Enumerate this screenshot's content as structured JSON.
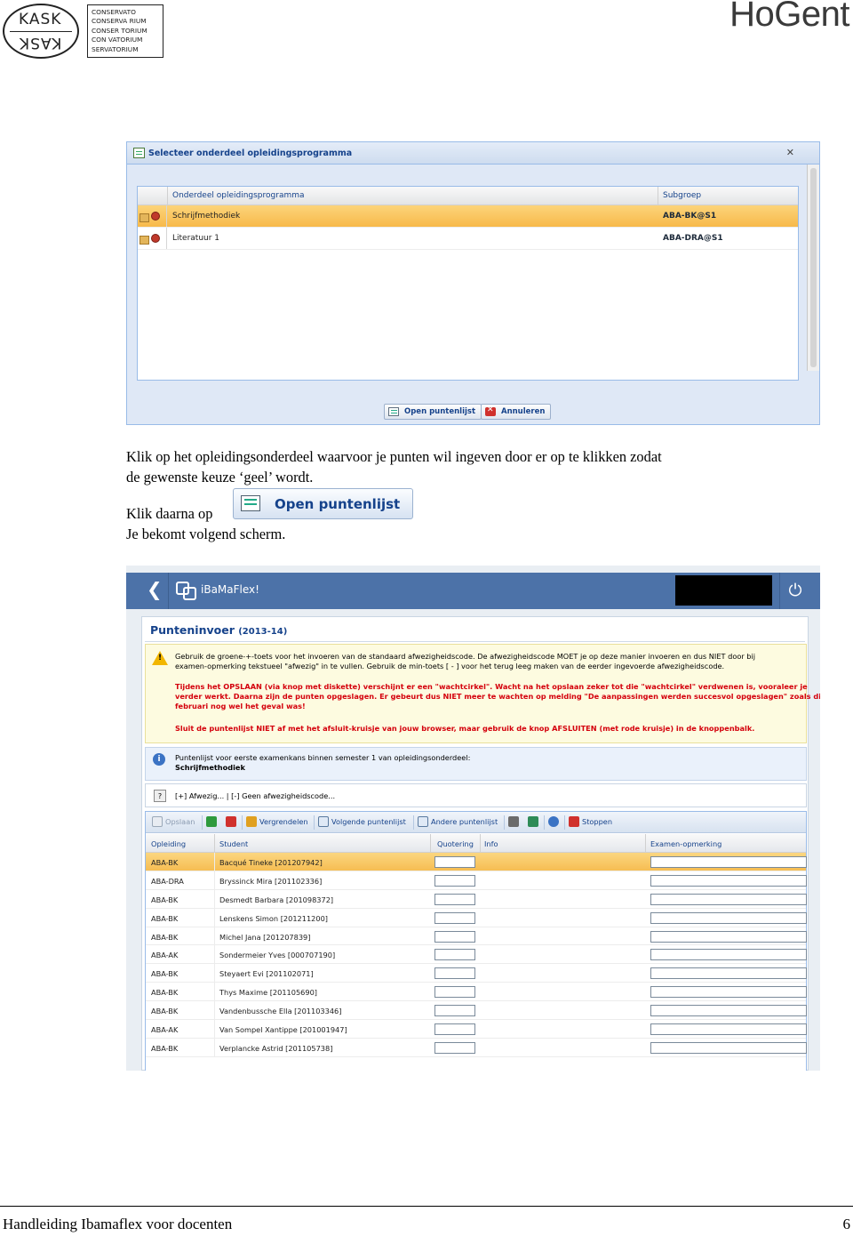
{
  "header": {
    "kask_logo_top": "KASK",
    "kask_logo_bottom": "KASK",
    "conservatorium_lines": [
      "CONSERVATO",
      "CONSERVA RIUM",
      "CONSER TORIUM",
      "CON VATORIUM",
      "SERVATORIUM"
    ],
    "hogent_logo": "HoGent"
  },
  "dialog": {
    "title": "Selecteer onderdeel opleidingsprogramma",
    "columns": [
      "Onderdeel opleidingsprogramma",
      "Subgroep"
    ],
    "rows": [
      {
        "onderdeel": "Schrijfmethodiek",
        "subgroep": "ABA-BK@S1",
        "selected": true
      },
      {
        "onderdeel": "Literatuur 1",
        "subgroep": "ABA-DRA@S1",
        "selected": false
      }
    ],
    "open_button": "Open puntenlijst",
    "cancel_button": "Annuleren",
    "close_glyph": "✕"
  },
  "text": {
    "line1": "Klik op het opleidingsonderdeel waarvoor je punten wil ingeven door er op te klikken zodat",
    "line2": "de gewenste keuze ‘geel’ wordt.",
    "line3": "Klik daarna op",
    "inline_button": "Open puntenlijst",
    "line4": "Je bekomt volgend scherm."
  },
  "app": {
    "name": "iBaMaFlex!",
    "back_glyph": "❮",
    "power_glyph": "⏻",
    "title": "Punteninvoer",
    "title_year": "(2013-14)",
    "warning_lines": [
      "Gebruik de groene-+-toets voor het invoeren van de standaard afwezigheidscode. De afwezigheidscode MOET je op deze manier invoeren en dus NIET door bij",
      "examen-opmerking tekstueel \"afwezig\" in te vullen. Gebruik de min-toets [ - ] voor het terug leeg maken van de eerder ingevoerde afwezigheidscode."
    ],
    "warning_red_lines": [
      "Tijdens het OPSLAAN (via knop met diskette) verschijnt er een \"wachtcirkel\". Wacht na het opslaan zeker tot die \"wachtcirkel\" verdwenen is, vooraleer je",
      "verder werkt. Daarna zijn de punten opgeslagen. Er gebeurt dus NIET meer te wachten op melding \"De aanpassingen werden succesvol opgeslagen\" zoals dit in",
      "februari nog wel het geval was!"
    ],
    "warning_red_last": "Sluit de puntenlijst NIET af met het afsluit-kruisje van jouw browser, maar gebruik de knop AFSLUITEN (met rode kruisje) in de knoppenbalk.",
    "info_line1": "Puntenlijst voor eerste examenkans binnen semester 1 van opleidingsonderdeel:",
    "info_line2": "Schrijfmethodiek",
    "legend": "[+] Afwezig... | [-] Geen afwezigheidscode...",
    "toolbar": {
      "save": "Opslaan",
      "enlarge": "Vergrendelen",
      "next": "Volgende puntenlijst",
      "other": "Andere puntenlijst",
      "stop": "Stoppen"
    },
    "columns": [
      "Opleiding",
      "Student",
      "Quotering",
      "Info",
      "Examen-opmerking"
    ],
    "rows": [
      {
        "opleiding": "ABA-BK",
        "student": "Bacqué Tineke [201207942]",
        "selected": true
      },
      {
        "opleiding": "ABA-DRA",
        "student": "Bryssinck Mira [201102336]"
      },
      {
        "opleiding": "ABA-BK",
        "student": "Desmedt Barbara [201098372]"
      },
      {
        "opleiding": "ABA-BK",
        "student": "Lenskens Simon [201211200]"
      },
      {
        "opleiding": "ABA-BK",
        "student": "Michel Jana [201207839]"
      },
      {
        "opleiding": "ABA-AK",
        "student": "Sondermeier Yves [000707190]"
      },
      {
        "opleiding": "ABA-BK",
        "student": "Steyaert Evi [201102071]"
      },
      {
        "opleiding": "ABA-BK",
        "student": "Thys Maxime [201105690]"
      },
      {
        "opleiding": "ABA-BK",
        "student": "Vandenbussche Ella [201103346]"
      },
      {
        "opleiding": "ABA-AK",
        "student": "Van Sompel Xantippe [201001947]"
      },
      {
        "opleiding": "ABA-BK",
        "student": "Verplancke Astrid [201105738]"
      }
    ]
  },
  "footer": {
    "title": "Handleiding Ibamaflex voor docenten",
    "page": "6"
  }
}
